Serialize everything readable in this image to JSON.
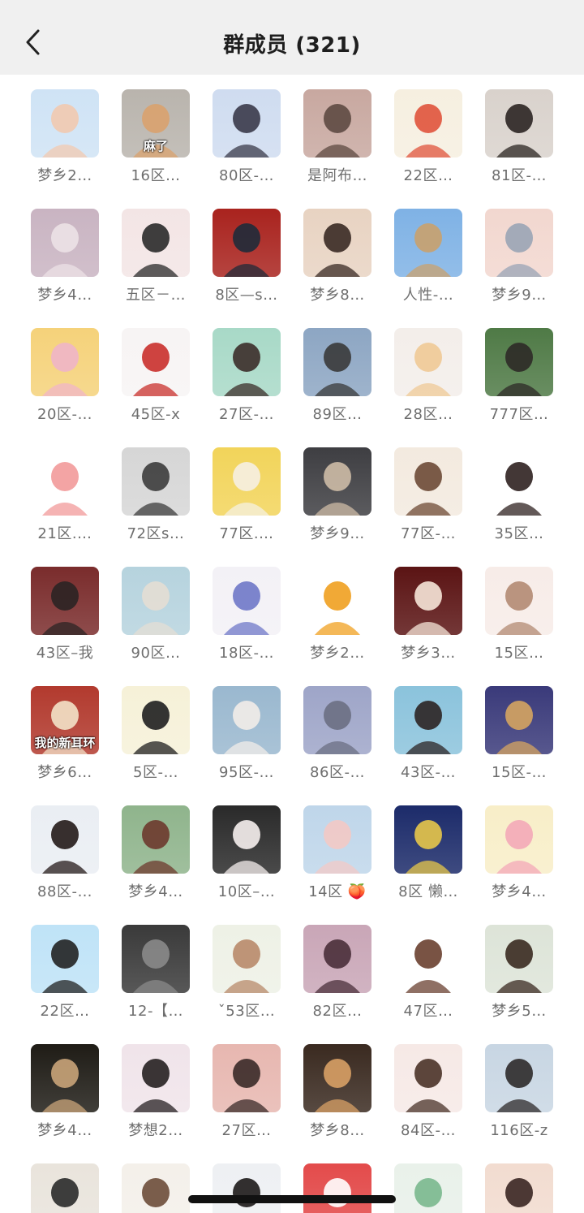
{
  "header": {
    "title": "群成员 (321)",
    "back_icon": "chevron-left-icon"
  },
  "members": [
    {
      "name": "梦乡2…",
      "avatar": "cartoon-girl-with-bear",
      "colors": [
        "#cfe3f5",
        "#f1c9b0"
      ]
    },
    {
      "name": "16区…",
      "avatar": "cat-on-carpet",
      "colors": [
        "#b9b4ad",
        "#d9a26e"
      ],
      "caption": "麻了"
    },
    {
      "name": "80区-…",
      "avatar": "cartoon-girl-puppy-hat",
      "colors": [
        "#cfdcf0",
        "#3a3a4a"
      ]
    },
    {
      "name": "是阿布…",
      "avatar": "person-portrait",
      "colors": [
        "#c8a8a0",
        "#5e4a42"
      ]
    },
    {
      "name": "22区…",
      "avatar": "cartoon-redhead-girl",
      "colors": [
        "#f6efe0",
        "#e0533c"
      ]
    },
    {
      "name": "81区-…",
      "avatar": "woman-portrait",
      "colors": [
        "#d9d2cc",
        "#2b2522"
      ]
    },
    {
      "name": "梦乡4…",
      "avatar": "mirror-duck-photo",
      "colors": [
        "#c9b4c2",
        "#ece2e6"
      ]
    },
    {
      "name": "五区－…",
      "avatar": "cartoon-devil-girl",
      "colors": [
        "#f3e5e5",
        "#2a2a2a"
      ]
    },
    {
      "name": "8区—s…",
      "avatar": "dual-gauges",
      "colors": [
        "#a9231e",
        "#1f2b3a"
      ]
    },
    {
      "name": "梦乡8…",
      "avatar": "girl-pout",
      "colors": [
        "#e8d3c2",
        "#3a2a24"
      ]
    },
    {
      "name": "人性-…",
      "avatar": "sky-reeds",
      "colors": [
        "#7fb2e5",
        "#c9a16d"
      ]
    },
    {
      "name": "梦乡9…",
      "avatar": "cartoon-bunny",
      "colors": [
        "#f2d7cf",
        "#9aa4b5"
      ]
    },
    {
      "name": "20区-…",
      "avatar": "anime-blonde-girl",
      "colors": [
        "#f5d27a",
        "#f0b5c8"
      ]
    },
    {
      "name": "45区-x",
      "avatar": "anime-white-hair",
      "colors": [
        "#f7f4f4",
        "#c9302c"
      ]
    },
    {
      "name": "27区-…",
      "avatar": "anime-girl-window",
      "colors": [
        "#a8d9c7",
        "#3c2e2a"
      ]
    },
    {
      "name": "89区…",
      "avatar": "man-landscape",
      "colors": [
        "#8da6c3",
        "#3a3a3a"
      ]
    },
    {
      "name": "28区…",
      "avatar": "cream-drink",
      "colors": [
        "#f3eeea",
        "#efc996"
      ]
    },
    {
      "name": "777区…",
      "avatar": "boy-in-garden",
      "colors": [
        "#4f7a46",
        "#2e2a27"
      ]
    },
    {
      "name": "21区.…",
      "avatar": "cartoon-cat-heart",
      "colors": [
        "#ffffff",
        "#f29a9a"
      ]
    },
    {
      "name": "72区s…",
      "avatar": "monochrome-portrait",
      "colors": [
        "#d6d6d6",
        "#3c3c3c"
      ]
    },
    {
      "name": "77区.…",
      "avatar": "girl-yellow-room",
      "colors": [
        "#f2d45a",
        "#f6f0e2"
      ]
    },
    {
      "name": "梦乡9…",
      "avatar": "blonde-girl-dark",
      "colors": [
        "#3e3e42",
        "#cdbba6"
      ]
    },
    {
      "name": "77区-…",
      "avatar": "cartoon-girl-goggles",
      "colors": [
        "#f3eadf",
        "#6d4a36"
      ]
    },
    {
      "name": "35区…",
      "avatar": "cat-ears-girl",
      "colors": [
        "#ffffff",
        "#2f2120"
      ]
    },
    {
      "name": "43区–我",
      "avatar": "man-red-shirt",
      "colors": [
        "#7a2c2c",
        "#2b2424"
      ]
    },
    {
      "name": "90区…",
      "avatar": "anime-boys-soft",
      "colors": [
        "#b6d3de",
        "#e4ded4"
      ]
    },
    {
      "name": "18区-…",
      "avatar": "blue-flowers",
      "colors": [
        "#f3f1f6",
        "#6f78c8"
      ]
    },
    {
      "name": "梦乡2…",
      "avatar": "orange-fruit",
      "colors": [
        "#ffffff",
        "#f0a020"
      ]
    },
    {
      "name": "梦乡3…",
      "avatar": "cartoon-crown-girl",
      "colors": [
        "#5b1414",
        "#f6e6d8"
      ]
    },
    {
      "name": "15区…",
      "avatar": "anime-girl-brown-hair",
      "colors": [
        "#f7ece8",
        "#b38a73"
      ]
    },
    {
      "name": "梦乡6…",
      "avatar": "man-meme",
      "colors": [
        "#b23a2e",
        "#f3e2c8"
      ],
      "caption": "我的新耳环"
    },
    {
      "name": "5区-…",
      "avatar": "mickey-mouse",
      "colors": [
        "#f6f1d8",
        "#1f1f1f"
      ]
    },
    {
      "name": "95区-…",
      "avatar": "girl-with-cat",
      "colors": [
        "#9ab8cf",
        "#f2ece8"
      ]
    },
    {
      "name": "86区-…",
      "avatar": "tom-cat",
      "colors": [
        "#9ea5c8",
        "#6b6f83"
      ]
    },
    {
      "name": "43区-…",
      "avatar": "maid-girl-dog",
      "colors": [
        "#8bc3dc",
        "#2c2424"
      ]
    },
    {
      "name": "15区-…",
      "avatar": "fantasy-girl-purple",
      "colors": [
        "#3a3a7a",
        "#d5a460"
      ]
    },
    {
      "name": "88区-…",
      "avatar": "girl-long-hair",
      "colors": [
        "#eaeef3",
        "#241a18"
      ]
    },
    {
      "name": "梦乡4…",
      "avatar": "girl-flowers",
      "colors": [
        "#8fb48c",
        "#6d3a2e"
      ]
    },
    {
      "name": "10区–…",
      "avatar": "white-bunny",
      "colors": [
        "#2a2a2a",
        "#f6efee"
      ]
    },
    {
      "name": "14区 🍑",
      "avatar": "sleeping-pig",
      "colors": [
        "#bfd6ea",
        "#f3c9c5"
      ]
    },
    {
      "name": "8区 懒…",
      "avatar": "night-girl-stars",
      "colors": [
        "#1c2b6a",
        "#e7c74a"
      ]
    },
    {
      "name": "梦乡4…",
      "avatar": "cartoon-pink-bunny",
      "colors": [
        "#f8eec8",
        "#f3a8b8"
      ]
    },
    {
      "name": "22区…",
      "avatar": "cartoon-panda",
      "colors": [
        "#bfe3f7",
        "#222222"
      ]
    },
    {
      "name": "12-【…",
      "avatar": "dark-texture",
      "colors": [
        "#3a3a3a",
        "#8a8a8a"
      ]
    },
    {
      "name": "ˇ53区…",
      "avatar": "child-face",
      "colors": [
        "#eef1e6",
        "#b88a6a"
      ]
    },
    {
      "name": "82区…",
      "avatar": "pink-hands",
      "colors": [
        "#c9a6b7",
        "#4a2f3a"
      ]
    },
    {
      "name": "47区…",
      "avatar": "cartoon-crown-kid",
      "colors": [
        "#ffffff",
        "#6a4030"
      ]
    },
    {
      "name": "梦乡5…",
      "avatar": "woman-braids",
      "colors": [
        "#dde4d8",
        "#3a2a20"
      ]
    },
    {
      "name": "梦乡4…",
      "avatar": "sleepy-cat",
      "colors": [
        "#1f1c16",
        "#c9a479"
      ]
    },
    {
      "name": "梦想2…",
      "avatar": "anime-twin-tails",
      "colors": [
        "#f0e4ea",
        "#262021"
      ]
    },
    {
      "name": "27区…",
      "avatar": "doll-girl-bear",
      "colors": [
        "#e7b7b0",
        "#3a2a28"
      ]
    },
    {
      "name": "梦乡8…",
      "avatar": "dog-and-panda",
      "colors": [
        "#3a2a20",
        "#d8a065"
      ]
    },
    {
      "name": "84区-…",
      "avatar": "anime-wink-girl",
      "colors": [
        "#f6e9e6",
        "#4a3328"
      ]
    },
    {
      "name": "116区-z",
      "avatar": "boy-blanket",
      "colors": [
        "#c8d6e3",
        "#2d2a2a"
      ]
    },
    {
      "name": "",
      "avatar": "person-hat",
      "colors": [
        "#e9e4dc",
        "#2a2a2a"
      ]
    },
    {
      "name": "",
      "avatar": "cartoon-girl-sketch",
      "colors": [
        "#f4f0ea",
        "#6d4d3a"
      ]
    },
    {
      "name": "",
      "avatar": "girl-dark-hair",
      "colors": [
        "#eef0f3",
        "#1d1a1a"
      ]
    },
    {
      "name": "",
      "avatar": "strawberry-bunny",
      "colors": [
        "#e34b4b",
        "#ffffff"
      ]
    },
    {
      "name": "",
      "avatar": "green-leaves",
      "colors": [
        "#e9f1ea",
        "#7ab88e"
      ]
    },
    {
      "name": "",
      "avatar": "girl-portrait-warm",
      "colors": [
        "#f2dcd0",
        "#3a2622"
      ]
    }
  ]
}
